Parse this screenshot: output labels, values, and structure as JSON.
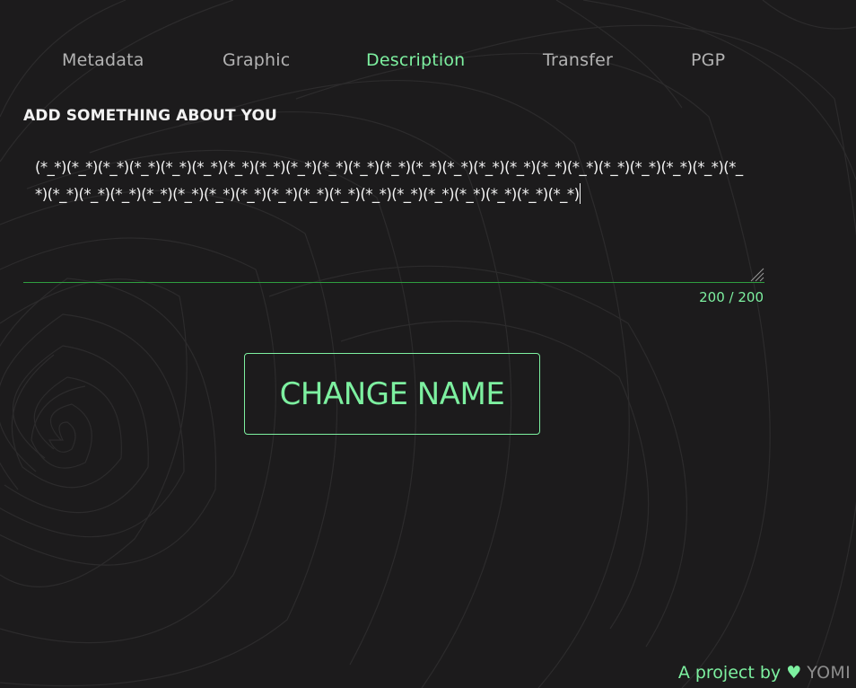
{
  "tabs": [
    {
      "label": "Metadata",
      "active": false
    },
    {
      "label": "Graphic",
      "active": false
    },
    {
      "label": "Description",
      "active": true
    },
    {
      "label": "Transfer",
      "active": false
    },
    {
      "label": "PGP",
      "active": false
    }
  ],
  "description": {
    "title": "ADD SOMETHING ABOUT YOU",
    "value": "(*_*)(*_*)(*_*)(*_*)(*_*)(*_*)(*_*)(*_*)(*_*)(*_*)(*_*)(*_*)(*_*)(*_*)(*_*)(*_*)(*_*)(*_*)(*_*)(*_*)(*_*)(*_*)(*_*)(*_*)(*_*)(*_*)(*_*)(*_*)(*_*)(*_*)(*_*)(*_*)(*_*)(*_*)(*_*)(*_*)(*_*)(*_*)(*_*)(*_*)",
    "counter": "200 / 200"
  },
  "action": {
    "button_label": "CHANGE NAME"
  },
  "footer": {
    "prefix": "A project by",
    "heart": "♥",
    "brand": "YOMI"
  },
  "colors": {
    "accent": "#7df0a0",
    "background": "#1c1b1c",
    "underline": "#2f9e3f",
    "tab_inactive": "#b3b3b3"
  },
  "icons": {
    "resize": "resize-grip-icon",
    "heart": "heart-icon"
  }
}
